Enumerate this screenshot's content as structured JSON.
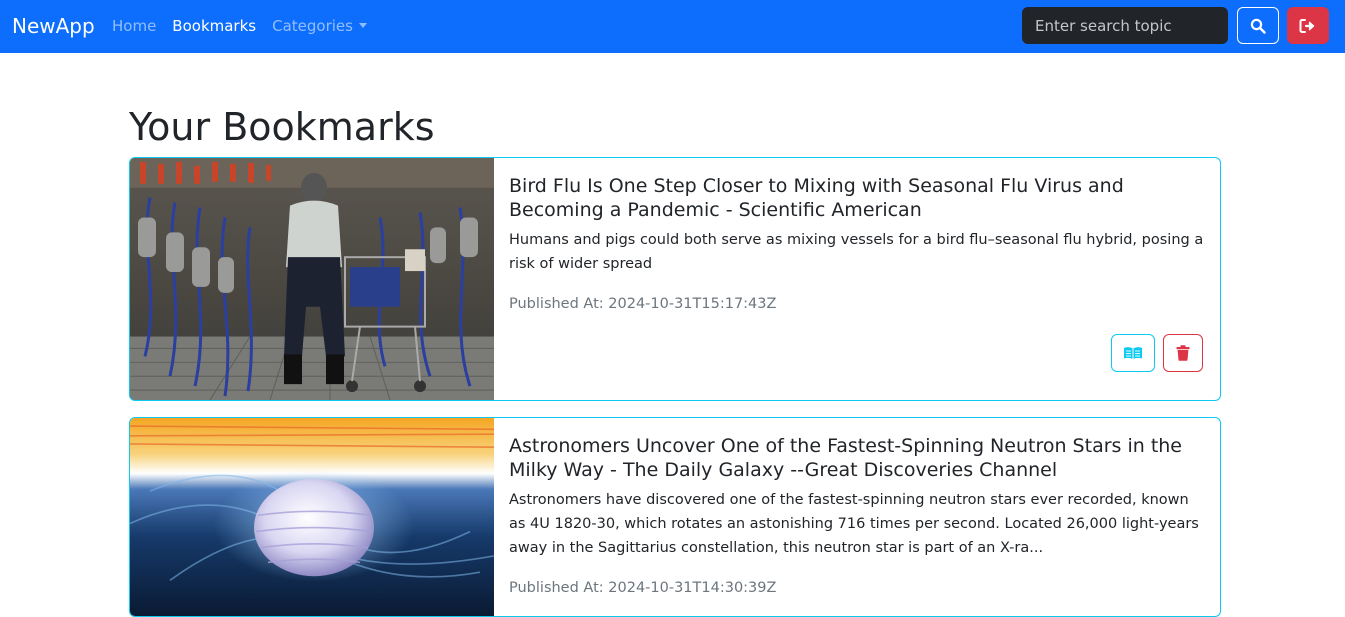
{
  "navbar": {
    "brand": "NewApp",
    "links": [
      {
        "label": "Home",
        "active": false
      },
      {
        "label": "Bookmarks",
        "active": true
      },
      {
        "label": "Categories",
        "active": false,
        "dropdown": true
      }
    ],
    "search_placeholder": "Enter search topic",
    "search_icon": "search-icon",
    "logout_icon": "logout-icon"
  },
  "page": {
    "title": "Your Bookmarks"
  },
  "bookmarks": [
    {
      "title": "Bird Flu Is One Step Closer to Mixing with Seasonal Flu Virus and Becoming a Pandemic - Scientific American",
      "description": "Humans and pigs could both serve as mixing vessels for a bird flu–seasonal flu hybrid, posing a risk of wider spread",
      "published": "Published At: 2024-10-31T15:17:43Z",
      "image": "dairy-milking-parlor-photo",
      "read_icon": "book-open-icon",
      "delete_icon": "trash-icon"
    },
    {
      "title": "Astronomers Uncover One of the Fastest-Spinning Neutron Stars in the Milky Way - The Daily Galaxy --Great Discoveries Channel",
      "description": "Astronomers have discovered one of the fastest-spinning neutron stars ever recorded, known as 4U 1820-30, which rotates an astonishing 716 times per second. Located 26,000 light-years away in the Sagittarius constellation, this neutron star is part of an X-ra...",
      "published": "Published At: 2024-10-31T14:30:39Z",
      "image": "neutron-star-illustration"
    }
  ],
  "colors": {
    "navbar_bg": "#0d6efd",
    "card_border": "#0dcaf0",
    "danger": "#dc3545",
    "muted_text": "#6c757d"
  }
}
